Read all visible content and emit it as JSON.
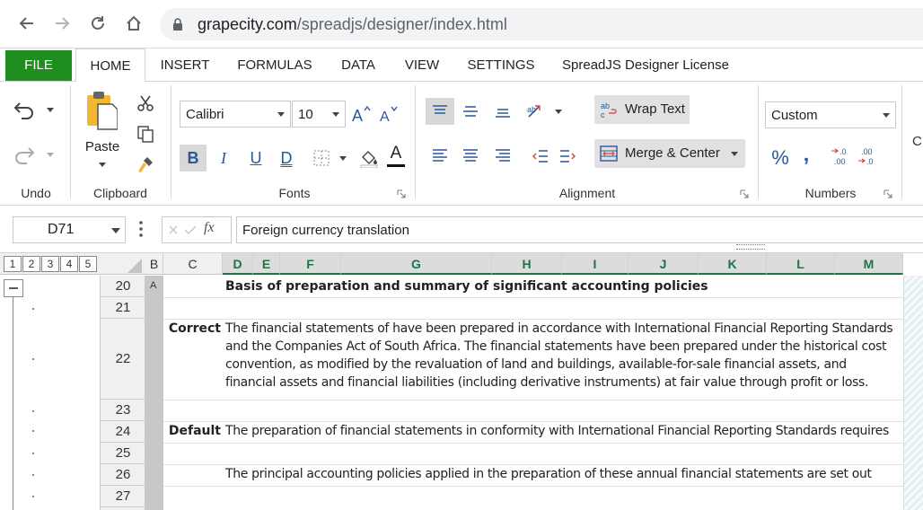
{
  "browser": {
    "url_host": "grapecity.com",
    "url_path": "/spreadjs/designer/index.html"
  },
  "tabs": [
    "FILE",
    "HOME",
    "INSERT",
    "FORMULAS",
    "DATA",
    "VIEW",
    "SETTINGS",
    "SpreadJS Designer License"
  ],
  "ribbon": {
    "undo_label": "Undo",
    "clipboard_label": "Clipboard",
    "paste_label": "Paste",
    "fonts_label": "Fonts",
    "font_name": "Calibri",
    "font_size": "10",
    "bold": "B",
    "italic": "I",
    "underline": "U",
    "double_underline": "D",
    "font_color_glyph": "A",
    "alignment_label": "Alignment",
    "wrap_text": "Wrap Text",
    "merge_center": "Merge & Center",
    "numbers_label": "Numbers",
    "number_format": "Custom",
    "percent": "%",
    "comma": "‚",
    "overflow_char": "C",
    "accent_color": "#217346",
    "file_color": "#1e8e1e"
  },
  "formula_bar": {
    "name_box": "D71",
    "fx": "fx",
    "formula": "Foreign currency translation"
  },
  "grid": {
    "outline_levels": [
      "1",
      "2",
      "3",
      "4",
      "5"
    ],
    "columns": [
      "B",
      "C",
      "D",
      "E",
      "F",
      "G",
      "H",
      "I",
      "J",
      "K",
      "L",
      "M"
    ],
    "rows": [
      "20",
      "21",
      "22",
      "23",
      "24",
      "25",
      "26",
      "27"
    ],
    "b20": "A",
    "d20": "Basis of preparation and summary of significant accounting policies",
    "c22": "Correct",
    "d22_lines": [
      "The financial statements of  have been prepared in accordance with International Financial Reporting Standards",
      "and the Companies Act of South Africa. The financial statements have been prepared under the historical cost",
      "convention, as modified by the revaluation of land and buildings, available-for-sale financial assets, and",
      "financial assets and financial liabilities (including derivative instruments) at fair value through profit or loss."
    ],
    "c24": "Default",
    "d24": "The preparation of financial statements in conformity with International Financial Reporting Standards requires",
    "d26": "The principal accounting policies applied in the preparation of these annual financial statements are set out"
  }
}
